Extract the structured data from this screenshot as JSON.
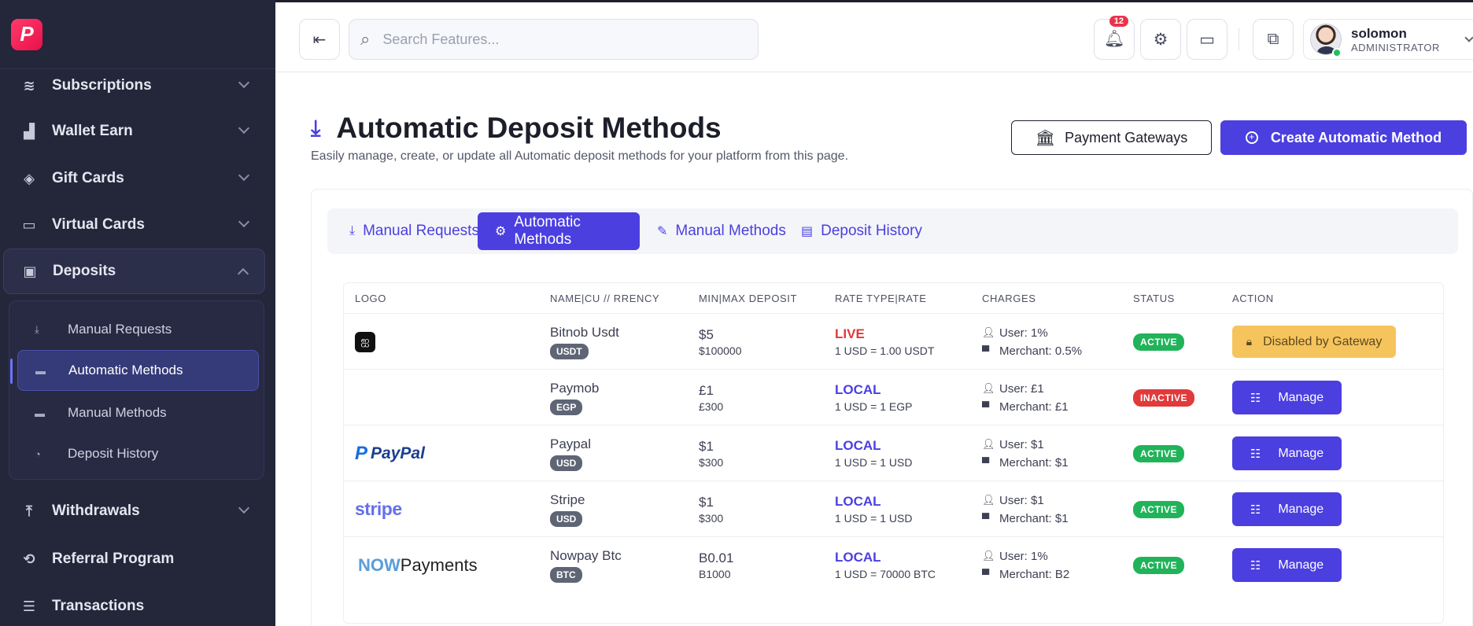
{
  "sidebar": {
    "items": [
      {
        "label": "Subscriptions",
        "icon": "layers-icon"
      },
      {
        "label": "Wallet Earn",
        "icon": "chart-up-icon"
      },
      {
        "label": "Gift Cards",
        "icon": "tag-icon"
      },
      {
        "label": "Virtual Cards",
        "icon": "card-icon"
      },
      {
        "label": "Deposits",
        "icon": "wallet-plus-icon"
      },
      {
        "label": "Withdrawals",
        "icon": "upload-tray-icon"
      },
      {
        "label": "Referral Program",
        "icon": "referral-icon"
      },
      {
        "label": "Transactions",
        "icon": "list-icon"
      }
    ],
    "deposits_sub": [
      {
        "label": "Manual Requests"
      },
      {
        "label": "Automatic Methods"
      },
      {
        "label": "Manual Methods"
      },
      {
        "label": "Deposit History"
      }
    ]
  },
  "topbar": {
    "search_placeholder": "Search Features...",
    "notification_count": "12",
    "user": {
      "name": "solomon",
      "role": "ADMINISTRATOR"
    }
  },
  "page": {
    "title": "Automatic Deposit Methods",
    "subtitle": "Easily manage, create, or update all Automatic deposit methods for your platform from this page.",
    "btn_gateways": "Payment Gateways",
    "btn_create": "Create Automatic Method",
    "accent_color": "#4b3fe0"
  },
  "tabs": [
    {
      "label": "Manual Requests"
    },
    {
      "label": "Automatic Methods"
    },
    {
      "label": "Manual Methods"
    },
    {
      "label": "Deposit History"
    }
  ],
  "table": {
    "headers": [
      "LOGO",
      "NAME|CU // RRENCY",
      "MIN|MAX DEPOSIT",
      "RATE TYPE|RATE",
      "CHARGES",
      "STATUS",
      "ACTION"
    ],
    "rows": [
      {
        "logo": "bitnob",
        "name": "Bitnob Usdt",
        "currency": "USDT",
        "min": "$5",
        "max": "$100000",
        "rate_type": "LIVE",
        "rate": "1 USD = 1.00 USDT",
        "user_charge": "User: 1%",
        "merchant_charge": "Merchant: 0.5%",
        "status": "ACTIVE",
        "action": "Disabled by Gateway"
      },
      {
        "logo": "",
        "name": "Paymob",
        "currency": "EGP",
        "min": "£1",
        "max": "£300",
        "rate_type": "LOCAL",
        "rate": "1 USD = 1 EGP",
        "user_charge": "User: £1",
        "merchant_charge": "Merchant: £1",
        "status": "INACTIVE",
        "action": "Manage"
      },
      {
        "logo": "PayPal",
        "name": "Paypal",
        "currency": "USD",
        "min": "$1",
        "max": "$300",
        "rate_type": "LOCAL",
        "rate": "1 USD = 1 USD",
        "user_charge": "User: $1",
        "merchant_charge": "Merchant: $1",
        "status": "ACTIVE",
        "action": "Manage"
      },
      {
        "logo": "stripe",
        "name": "Stripe",
        "currency": "USD",
        "min": "$1",
        "max": "$300",
        "rate_type": "LOCAL",
        "rate": "1 USD = 1 USD",
        "user_charge": "User: $1",
        "merchant_charge": "Merchant: $1",
        "status": "ACTIVE",
        "action": "Manage"
      },
      {
        "logo": "NOWPayments",
        "logo_a": "NOW",
        "logo_b": "Payments",
        "name": "Nowpay Btc",
        "currency": "BTC",
        "min": "B0.01",
        "max": "B1000",
        "rate_type": "LOCAL",
        "rate": "1 USD = 70000 BTC",
        "user_charge": "User: 1%",
        "merchant_charge": "Merchant: B2",
        "status": "ACTIVE",
        "action": "Manage"
      }
    ]
  }
}
